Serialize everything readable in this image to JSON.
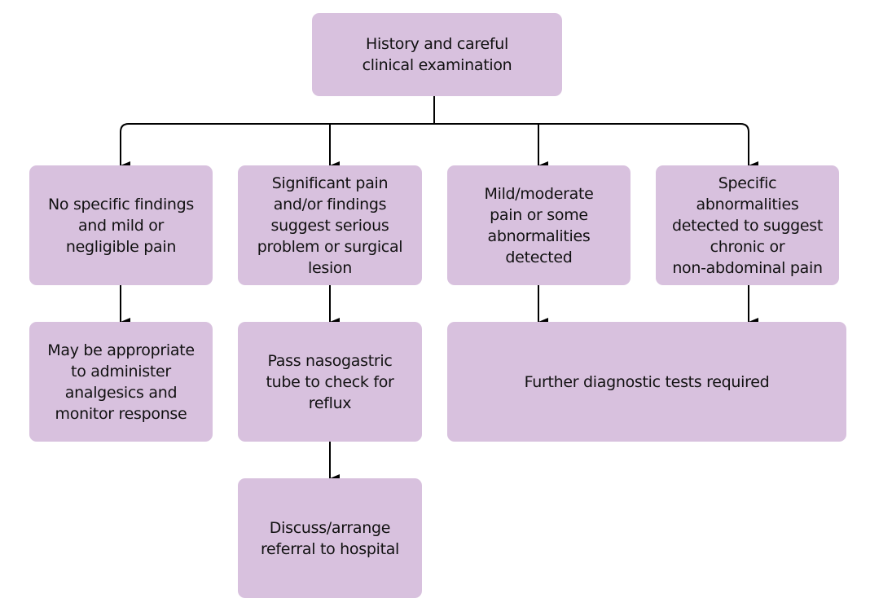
{
  "diagram": {
    "type": "flowchart",
    "colors": {
      "box_fill": "#d8c1de",
      "text": "#111111",
      "connector": "#000000"
    },
    "nodes": {
      "root": "History and careful\nclinical examination",
      "no_findings": "No specific findings\nand mild or\nnegligible pain",
      "significant_pain": "Significant pain\nand/or findings\nsuggest serious\nproblem or surgical\nlesion",
      "mild_moderate": "Mild/moderate\npain or some\nabnormalities\ndetected",
      "specific_abnormalities": "Specific\nabnormalities\ndetected to suggest\nchronic or\nnon-abdominal pain",
      "analgesics": "May be appropriate\nto administer\nanalgesics and\nmonitor response",
      "nasogastric": "Pass nasogastric\ntube to check for\nreflux",
      "further_tests": "Further diagnostic tests required",
      "referral": "Discuss/arrange\nreferral to hospital"
    },
    "edges": [
      [
        "root",
        "no_findings"
      ],
      [
        "root",
        "significant_pain"
      ],
      [
        "root",
        "mild_moderate"
      ],
      [
        "root",
        "specific_abnormalities"
      ],
      [
        "no_findings",
        "analgesics"
      ],
      [
        "significant_pain",
        "nasogastric"
      ],
      [
        "mild_moderate",
        "further_tests"
      ],
      [
        "specific_abnormalities",
        "further_tests"
      ],
      [
        "nasogastric",
        "referral"
      ]
    ]
  }
}
